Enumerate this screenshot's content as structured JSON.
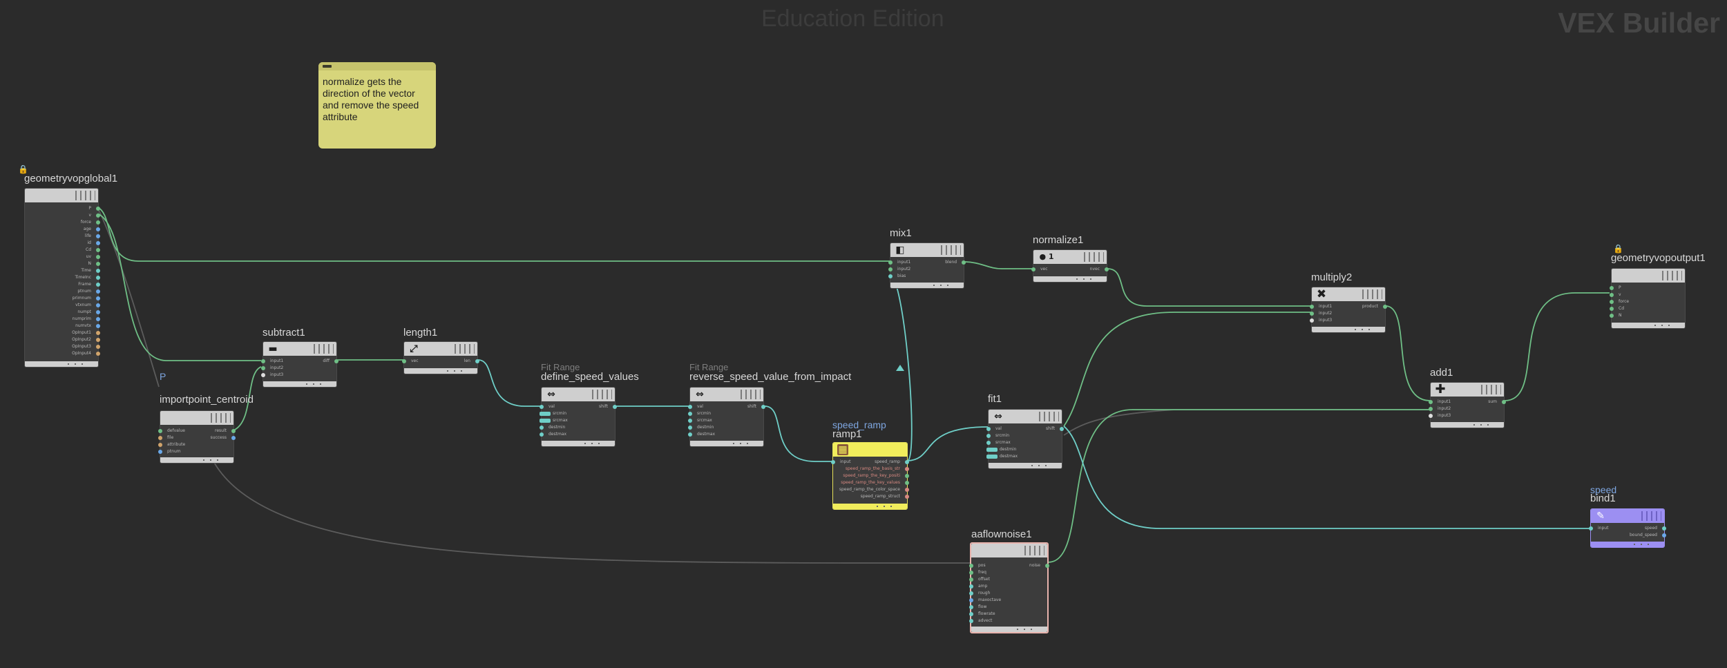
{
  "watermark": "Education Edition",
  "context": "VEX Builder",
  "sticky_note": {
    "text": "normalize gets the direction of the vector and remove the speed attribute",
    "color": "#d7d57b"
  },
  "colors": {
    "wire_green": "#6fbf86",
    "wire_cyan": "#6fcfc8",
    "wire_gray": "#5c5c5c",
    "highlight_node": "#f1ed5c",
    "bind_node": "#9c8ff2",
    "selected_border": "#e8b3ad"
  },
  "nodes": {
    "geometryvopglobal": {
      "name": "geometryvopglobal1",
      "icon": "lock-icon",
      "outputs": [
        "P",
        "v",
        "force",
        "age",
        "life",
        "id",
        "Cd",
        "uv",
        "N",
        "Time",
        "TimeInc",
        "Frame",
        "ptnum",
        "primnum",
        "vtxnum",
        "numpt",
        "numprim",
        "numvtx",
        "OpInput1",
        "OpInput2",
        "OpInput3",
        "OpInput4"
      ]
    },
    "importpoint": {
      "name": "importpoint_centroid",
      "tag": "P",
      "inputs": [
        "defvalue",
        "file",
        "attribute",
        "ptnum"
      ],
      "outputs": [
        "result",
        "success"
      ]
    },
    "subtract": {
      "name": "subtract1",
      "icon": "minus-icon",
      "inputs": [
        "input1",
        "input2",
        "input3"
      ],
      "outputs": [
        "diff"
      ]
    },
    "length": {
      "name": "length1",
      "icon": "ruler-icon",
      "inputs": [
        "vec"
      ],
      "outputs": [
        "len"
      ]
    },
    "define_speed": {
      "name": "define_speed_values",
      "tag": "Fit Range",
      "icon": "fit-icon",
      "inputs": [
        "val",
        "srcmin",
        "srcmax",
        "destmin",
        "destmax"
      ],
      "outputs": [
        "shift"
      ]
    },
    "reverse_speed": {
      "name": "reverse_speed_value_from_impact",
      "tag": "Fit Range",
      "icon": "fit-icon",
      "inputs": [
        "val",
        "srcmin",
        "srcmax",
        "destmin",
        "destmax"
      ],
      "outputs": [
        "shift"
      ]
    },
    "ramp": {
      "name": "ramp1",
      "tag": "speed_ramp",
      "icon": "ramp-icon",
      "inputs": [
        "input"
      ],
      "outputs": [
        "speed_ramp",
        "speed_ramp_the_basis_str",
        "speed_ramp_the_key_positi",
        "speed_ramp_the_key_values",
        "speed_ramp_the_color_space",
        "speed_ramp_struct"
      ]
    },
    "mix": {
      "name": "mix1",
      "icon": "mix-icon",
      "inputs": [
        "input1",
        "input2",
        "bias"
      ],
      "outputs": [
        "blend"
      ]
    },
    "normalize": {
      "name": "normalize1",
      "icon": "normalize-icon",
      "inputs": [
        "vec"
      ],
      "outputs": [
        "nvec"
      ]
    },
    "fit": {
      "name": "fit1",
      "icon": "fit-icon",
      "inputs": [
        "val",
        "srcmin",
        "srcmax",
        "destmin",
        "destmax"
      ],
      "outputs": [
        "shift"
      ]
    },
    "multiply": {
      "name": "multiply2",
      "icon": "multiply-icon",
      "inputs": [
        "input1",
        "input2",
        "input3"
      ],
      "outputs": [
        "product"
      ]
    },
    "add": {
      "name": "add1",
      "icon": "plus-icon",
      "inputs": [
        "input1",
        "input2",
        "input3"
      ],
      "outputs": [
        "sum"
      ]
    },
    "output": {
      "name": "geometryvopoutput1",
      "icon": "lock-icon",
      "inputs": [
        "P",
        "v",
        "force",
        "Cd",
        "N"
      ]
    },
    "bind": {
      "name": "bind1",
      "tag": "speed",
      "icon": "bind-icon",
      "inputs": [
        "input"
      ],
      "outputs": [
        "speed",
        "bound_speed"
      ]
    },
    "aaflownoise": {
      "name": "aaflownoise1",
      "inputs": [
        "pos",
        "freq",
        "offset",
        "amp",
        "rough",
        "maxoctave",
        "flow",
        "flowrate",
        "advect"
      ],
      "outputs": [
        "noise"
      ]
    }
  }
}
